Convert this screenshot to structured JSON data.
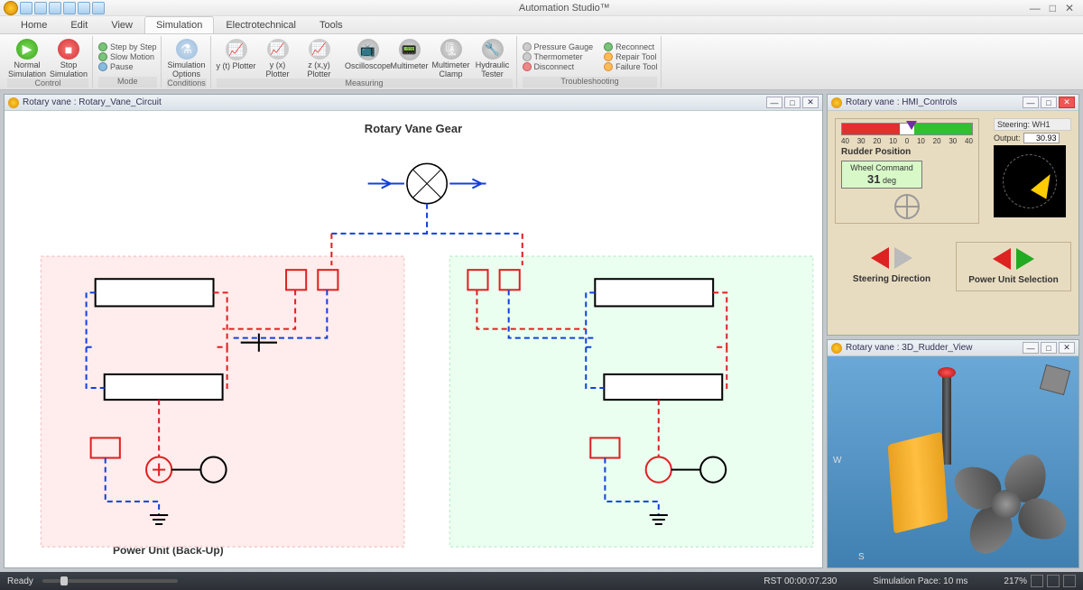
{
  "app_title": "Automation Studio™",
  "tabs": [
    "Home",
    "Edit",
    "View",
    "Simulation",
    "Electrotechnical",
    "Tools"
  ],
  "active_tab": 3,
  "ribbon": {
    "control": {
      "label": "Control",
      "normal": "Normal Simulation",
      "stop": "Stop Simulation"
    },
    "mode": {
      "label": "Mode",
      "step": "Step by Step",
      "slow": "Slow Motion",
      "pause": "Pause"
    },
    "conditions": {
      "label": "Conditions",
      "btn": "Simulation Options"
    },
    "measuring": {
      "label": "Measuring",
      "yt": "y (t) Plotter",
      "yx": "y (x) Plotter",
      "zxy": "z (x,y) Plotter",
      "osc": "Oscilloscope",
      "mm": "Multimeter",
      "mmc": "Multimeter Clamp",
      "ht": "Hydraulic Tester"
    },
    "troubleshoot": {
      "label": "Troubleshooting",
      "pg": "Pressure Gauge",
      "th": "Thermometer",
      "disc": "Disconnect",
      "rec": "Reconnect",
      "rep": "Repair Tool",
      "fail": "Failure Tool"
    }
  },
  "child_windows": {
    "circuit": {
      "title": "Rotary vane : Rotary_Vane_Circuit",
      "heading": "Rotary Vane Gear",
      "unit_label": "Power Unit (Back-Up)"
    },
    "hmi": {
      "title": "Rotary vane : HMI_Controls",
      "ticks": [
        "40",
        "30",
        "20",
        "10",
        "0",
        "10",
        "20",
        "30",
        "40"
      ],
      "rudder_label": "Rudder Position",
      "wheel_cmd_label": "Wheel Command",
      "wheel_cmd_value": "31",
      "wheel_cmd_unit": "deg",
      "steering_name": "Steering: WH1",
      "output_label": "Output:",
      "output_value": "30.93",
      "steer_dir": "Steering Direction",
      "pus": "Power Unit Selection"
    },
    "view3d": {
      "title": "Rotary vane : 3D_Rudder_View"
    }
  },
  "statusbar": {
    "ready": "Ready",
    "rst": "RST 00:00:07.230",
    "pace": "Simulation Pace: 10 ms",
    "zoom": "217%"
  }
}
